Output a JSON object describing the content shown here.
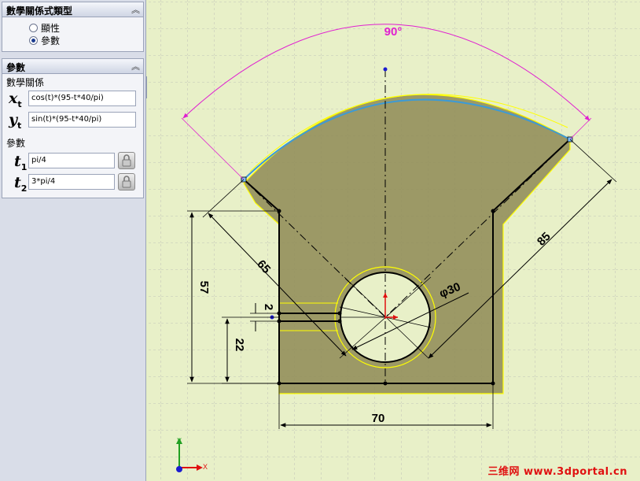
{
  "panel": {
    "section1": {
      "title": "數學關係式類型",
      "options": [
        "顯性",
        "參數"
      ],
      "selected": "參數"
    },
    "section2": {
      "title": "參數",
      "relation_label": "數學關係",
      "xt": {
        "var": "x",
        "sub": "t",
        "value": "cos(t)*(95-t*40/pi)"
      },
      "yt": {
        "var": "y",
        "sub": "t",
        "value": "sin(t)*(95-t*40/pi)"
      },
      "params_label": "參數",
      "t1": {
        "var": "t",
        "sub": "1",
        "value": "pi/4"
      },
      "t2": {
        "var": "t",
        "sub": "2",
        "value": "3*pi/4"
      }
    }
  },
  "sketch": {
    "dimensions": {
      "angle": "90°",
      "d57": "57",
      "d65": "65",
      "d85": "85",
      "d70": "70",
      "d22": "22",
      "d2": "2",
      "phi30": "φ30"
    },
    "axis": {
      "y": "Y",
      "x": "X"
    },
    "colors": {
      "background": "#e8f0c8",
      "grid": "#bdbdbd",
      "fill": "#8e8a55",
      "highlight": "#ffff00",
      "curve": "#3c9ad6",
      "angle_dim": "#e020d0",
      "dims": "#000000"
    }
  },
  "watermark": "三维网 www.3dportal.cn"
}
